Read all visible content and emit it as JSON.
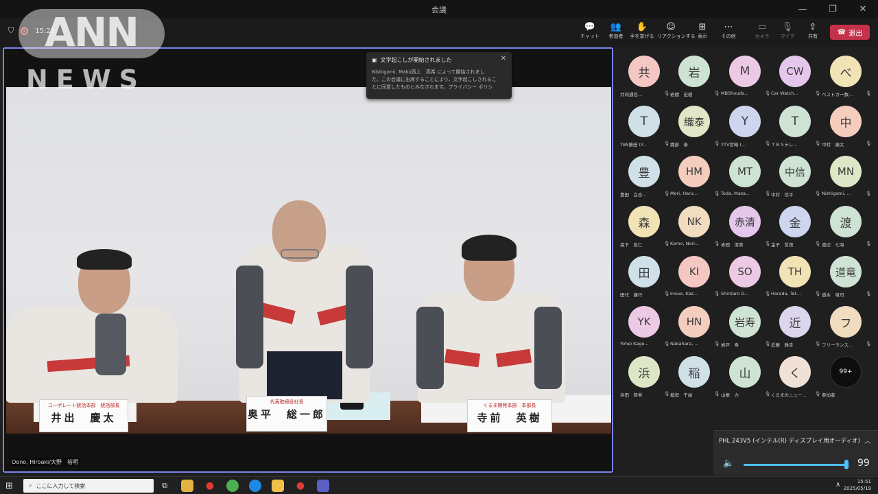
{
  "window": {
    "title": "会議",
    "minimize": "—",
    "maximize": "❐",
    "close": "✕"
  },
  "toolbar": {
    "timer": "15:21",
    "buttons": [
      {
        "label": "チャット",
        "icon": "chat-icon"
      },
      {
        "label": "参加者",
        "icon": "people-icon"
      },
      {
        "label": "手を挙げる",
        "icon": "raise-hand-icon"
      },
      {
        "label": "リアクションする",
        "icon": "reaction-icon"
      },
      {
        "label": "表示",
        "icon": "view-icon"
      },
      {
        "label": "その他",
        "icon": "more-icon"
      },
      {
        "label": "カメラ",
        "icon": "camera-off-icon"
      },
      {
        "label": "マイク",
        "icon": "mic-off-icon"
      },
      {
        "label": "共有",
        "icon": "share-icon"
      }
    ],
    "leave_label": "退出"
  },
  "logo": {
    "ann": "ANN",
    "news": "NEWS"
  },
  "caption_popup": {
    "title": "文字起こしが開始されました",
    "body_line1": "Nishigami, Maki/西上　真希 によって開始されまし",
    "body_line2": "た。この会議に出席することにより、文字起こしされるこ",
    "body_line3": "とに同意したものとみなされます。プライバシー ポリシ"
  },
  "stage": {
    "caption": "Oono, Hiroaki/大野　裕明",
    "nameplates": [
      {
        "org": "コーポレート統括本部　統括部長",
        "name": "井出　慶太"
      },
      {
        "org": "代表取締役社長",
        "name": "奥平　総一郎"
      },
      {
        "org": "くるま開発本部　本部長",
        "name": "寺前　英樹"
      }
    ]
  },
  "participants": [
    {
      "initials": "共",
      "name": "共同通信...",
      "bg": "#f4c7c3"
    },
    {
      "initials": "岩",
      "name": "岩間　宏樹",
      "bg": "#cfe3d4"
    },
    {
      "initials": "M",
      "name": "MBShoudo...",
      "bg": "#ecc9e4"
    },
    {
      "initials": "CW",
      "name": "Car Watch...",
      "bg": "#e6c7ec"
    },
    {
      "initials": "べ",
      "name": "ベストカー数...",
      "bg": "#f2e3b7"
    },
    {
      "initials": "T",
      "name": "TBS勝田 (Y...",
      "bg": "#cfe0e8"
    },
    {
      "initials": "織泰",
      "name": "織部　泰",
      "bg": "#e2e6c6"
    },
    {
      "initials": "Y",
      "name": "YTV宮崎 (...",
      "bg": "#cdd6ee"
    },
    {
      "initials": "T",
      "name": "ＴＢＳテレ...",
      "bg": "#cfe3d4"
    },
    {
      "initials": "中",
      "name": "中村　康太",
      "bg": "#f4cdbf"
    },
    {
      "initials": "豊",
      "name": "豊田　白合...",
      "bg": "#cfe0e8"
    },
    {
      "initials": "HM",
      "name": "Mori, Haru...",
      "bg": "#f4cdbf"
    },
    {
      "initials": "MT",
      "name": "Toda, Masa...",
      "bg": "#cfe3d4"
    },
    {
      "initials": "中信",
      "name": "中村　信平",
      "bg": "#cfe3d4"
    },
    {
      "initials": "MN",
      "name": "Nishigami, ...",
      "bg": "#dde6c6"
    },
    {
      "initials": "森",
      "name": "森下　友仁",
      "bg": "#f2e3b7"
    },
    {
      "initials": "NK",
      "name": "Kamo, Nori...",
      "bg": "#f2dcc0"
    },
    {
      "initials": "赤清",
      "name": "赤間　清美",
      "bg": "#e6c7ec"
    },
    {
      "initials": "金",
      "name": "金子　哲茂",
      "bg": "#cdd6ee"
    },
    {
      "initials": "渡",
      "name": "渡辺　七海",
      "bg": "#cfe3d4"
    },
    {
      "initials": "田",
      "name": "田代　康行",
      "bg": "#cfe0e8"
    },
    {
      "initials": "KI",
      "name": "Inoue, Kaz...",
      "bg": "#f4c7c3"
    },
    {
      "initials": "SO",
      "name": "Shintaro O...",
      "bg": "#ecc9e4"
    },
    {
      "initials": "TH",
      "name": "Harada, Tet...",
      "bg": "#f2e3b7"
    },
    {
      "initials": "道竜",
      "name": "道本　竜司",
      "bg": "#cfe3d4"
    },
    {
      "initials": "YK",
      "name": "Yohei Kage...",
      "bg": "#ecc9e4"
    },
    {
      "initials": "HN",
      "name": "Nakahara, ...",
      "bg": "#f4cdbf"
    },
    {
      "initials": "岩寿",
      "name": "岩戸　寿",
      "bg": "#cfe3d4"
    },
    {
      "initials": "近",
      "name": "近藤　雅幸",
      "bg": "#dcd5ee"
    },
    {
      "initials": "フ",
      "name": "フリーランス...",
      "bg": "#f2dcc0"
    },
    {
      "initials": "浜",
      "name": "浜田　恭寿",
      "bg": "#dde6c6"
    },
    {
      "initials": "稲",
      "name": "稲垣　千絵",
      "bg": "#cfe0e8"
    },
    {
      "initials": "山",
      "name": "山根　力",
      "bg": "#cfe3d4"
    },
    {
      "initials": "く",
      "name": "くるまのニュー...",
      "bg": "#f1e0d4"
    },
    {
      "initials": "99+",
      "name": "参加者",
      "bg": "#0d0d0d"
    }
  ],
  "volume": {
    "device": "PHL 243V5 (インテル(R) ディスプレイ用オーディオ)",
    "value": 99,
    "level_fraction": 0.99
  },
  "taskbar": {
    "search_placeholder": "ここに入力して検索",
    "time": "15:51",
    "date": "2025/05/19"
  }
}
